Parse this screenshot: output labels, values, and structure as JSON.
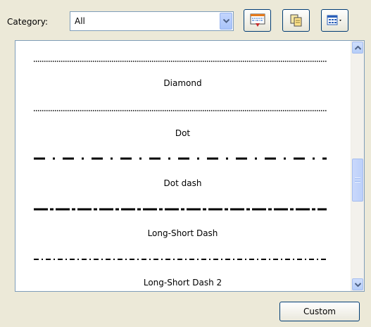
{
  "category": {
    "label": "Category:",
    "selected": "All"
  },
  "toolbar": {
    "buttons": [
      "line-styles-icon",
      "copy-pages-icon",
      "grid-view-dropdown-icon"
    ]
  },
  "styles": [
    {
      "name": "Diamond",
      "pattern": "dotted"
    },
    {
      "name": "Dot",
      "pattern": "dash-dot"
    },
    {
      "name": "Dot dash",
      "pattern": "long-short"
    },
    {
      "name": "Long-Short Dash",
      "pattern": "dash-dot-small"
    },
    {
      "name": "Long-Short Dash 2",
      "pattern": ""
    }
  ],
  "scroll_position": 0.58,
  "custom_button_label": "Custom"
}
